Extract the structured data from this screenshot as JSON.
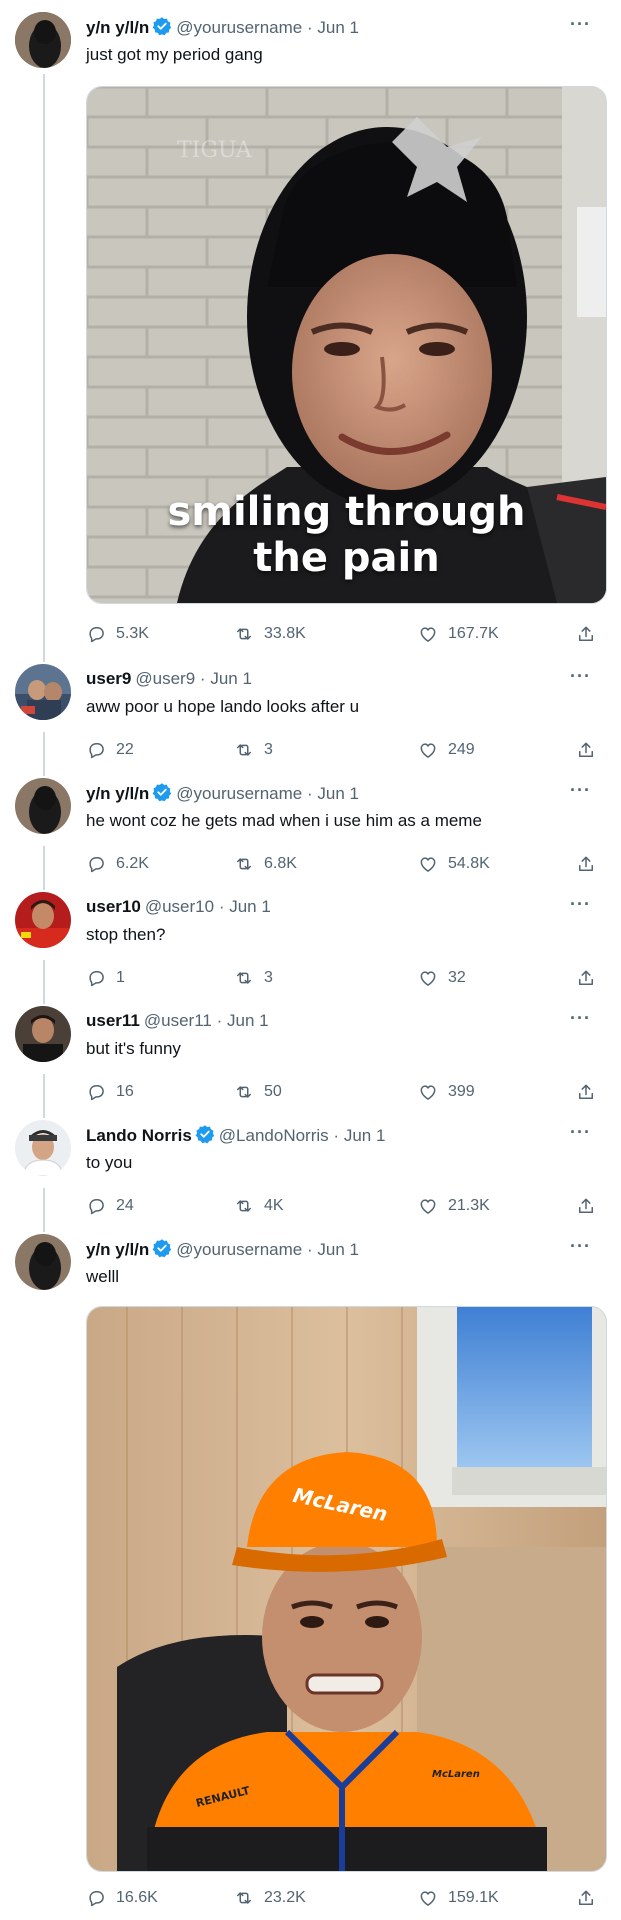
{
  "tweets": [
    {
      "name": "y/n y/l/n",
      "verified": true,
      "handle": "@yourusername",
      "date": "Jun 1",
      "text": "just got my period gang",
      "media_caption": "smiling through\nthe pain",
      "replies": "5.3K",
      "retweets": "33.8K",
      "likes": "167.7K"
    },
    {
      "name": "user9",
      "verified": false,
      "handle": "@user9",
      "date": "Jun 1",
      "text": "aww poor u hope lando looks after u",
      "replies": "22",
      "retweets": "3",
      "likes": "249"
    },
    {
      "name": "y/n y/l/n",
      "verified": true,
      "handle": "@yourusername",
      "date": "Jun 1",
      "text": "he wont coz he gets mad when i use him as a meme",
      "replies": "6.2K",
      "retweets": "6.8K",
      "likes": "54.8K"
    },
    {
      "name": "user10",
      "verified": false,
      "handle": "@user10",
      "date": "Jun 1",
      "text": "stop then?",
      "replies": "1",
      "retweets": "3",
      "likes": "32"
    },
    {
      "name": "user11",
      "verified": false,
      "handle": "@user11",
      "date": "Jun 1",
      "text": "but it's funny",
      "replies": "16",
      "retweets": "50",
      "likes": "399"
    },
    {
      "name": "Lando Norris",
      "verified": true,
      "handle": "@LandoNorris",
      "date": "Jun 1",
      "text": "to you",
      "replies": "24",
      "retweets": "4K",
      "likes": "21.3K"
    },
    {
      "name": "y/n y/l/n",
      "verified": true,
      "handle": "@yourusername",
      "date": "Jun 1",
      "text": "welll",
      "replies": "16.6K",
      "retweets": "23.2K",
      "likes": "159.1K"
    }
  ],
  "date_separator": "·",
  "more_glyph": "···",
  "icons": {
    "reply": "reply-icon",
    "retweet": "retweet-icon",
    "like": "like-icon",
    "share": "share-icon",
    "verified": "verified-badge-icon",
    "more": "more-icon"
  },
  "colors": {
    "verified": "#1d9bf0",
    "secondary_text": "#536471",
    "thread_line": "#cfd9de",
    "mclaren_orange": "#ff8000"
  }
}
